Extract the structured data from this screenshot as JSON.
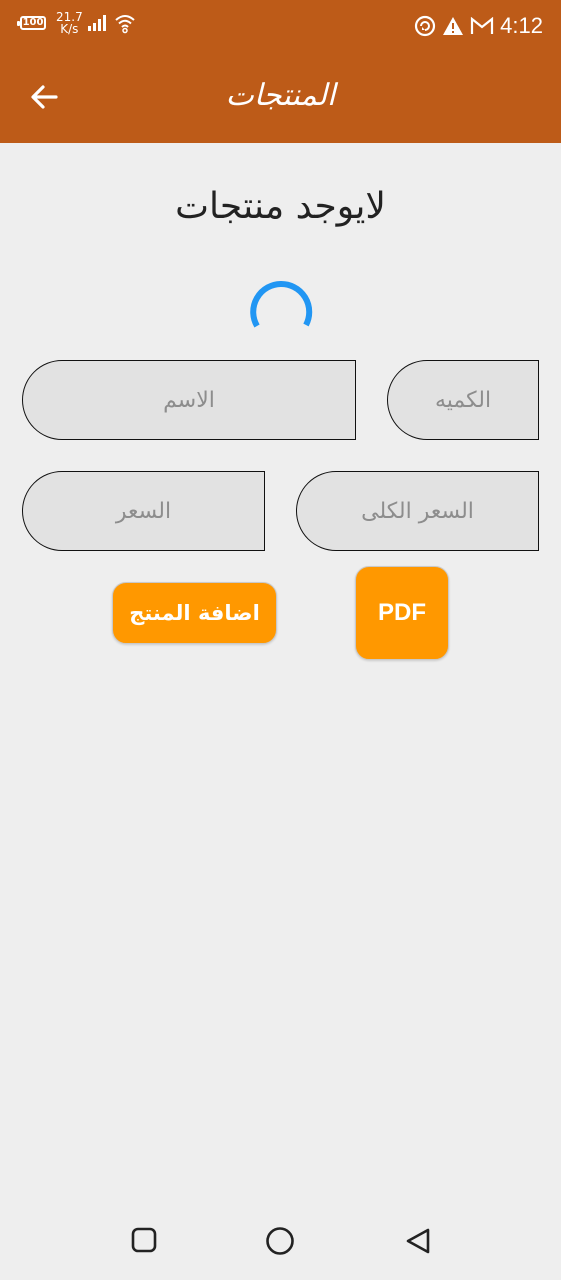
{
  "status_bar": {
    "battery": "100",
    "net_speed_value": "21.7",
    "net_speed_unit": "K/s",
    "time": "4:12"
  },
  "app_bar": {
    "title": "المنتجات"
  },
  "main": {
    "empty_message": "لايوجد منتجات",
    "fields": {
      "name_placeholder": "الاسم",
      "quantity_placeholder": "الكميه",
      "price_placeholder": "السعر",
      "total_price_placeholder": "السعر الكلى"
    },
    "add_product_label": "اضافة المنتج",
    "pdf_label": "PDF"
  },
  "colors": {
    "app_bar": "#bd5b18",
    "accent_button": "#ff9800",
    "spinner": "#2196f3",
    "background": "#eeeeee"
  },
  "icons": {
    "back": "arrow-left-icon",
    "nav_recents": "square-icon",
    "nav_home": "circle-icon",
    "nav_back": "triangle-back-icon"
  }
}
